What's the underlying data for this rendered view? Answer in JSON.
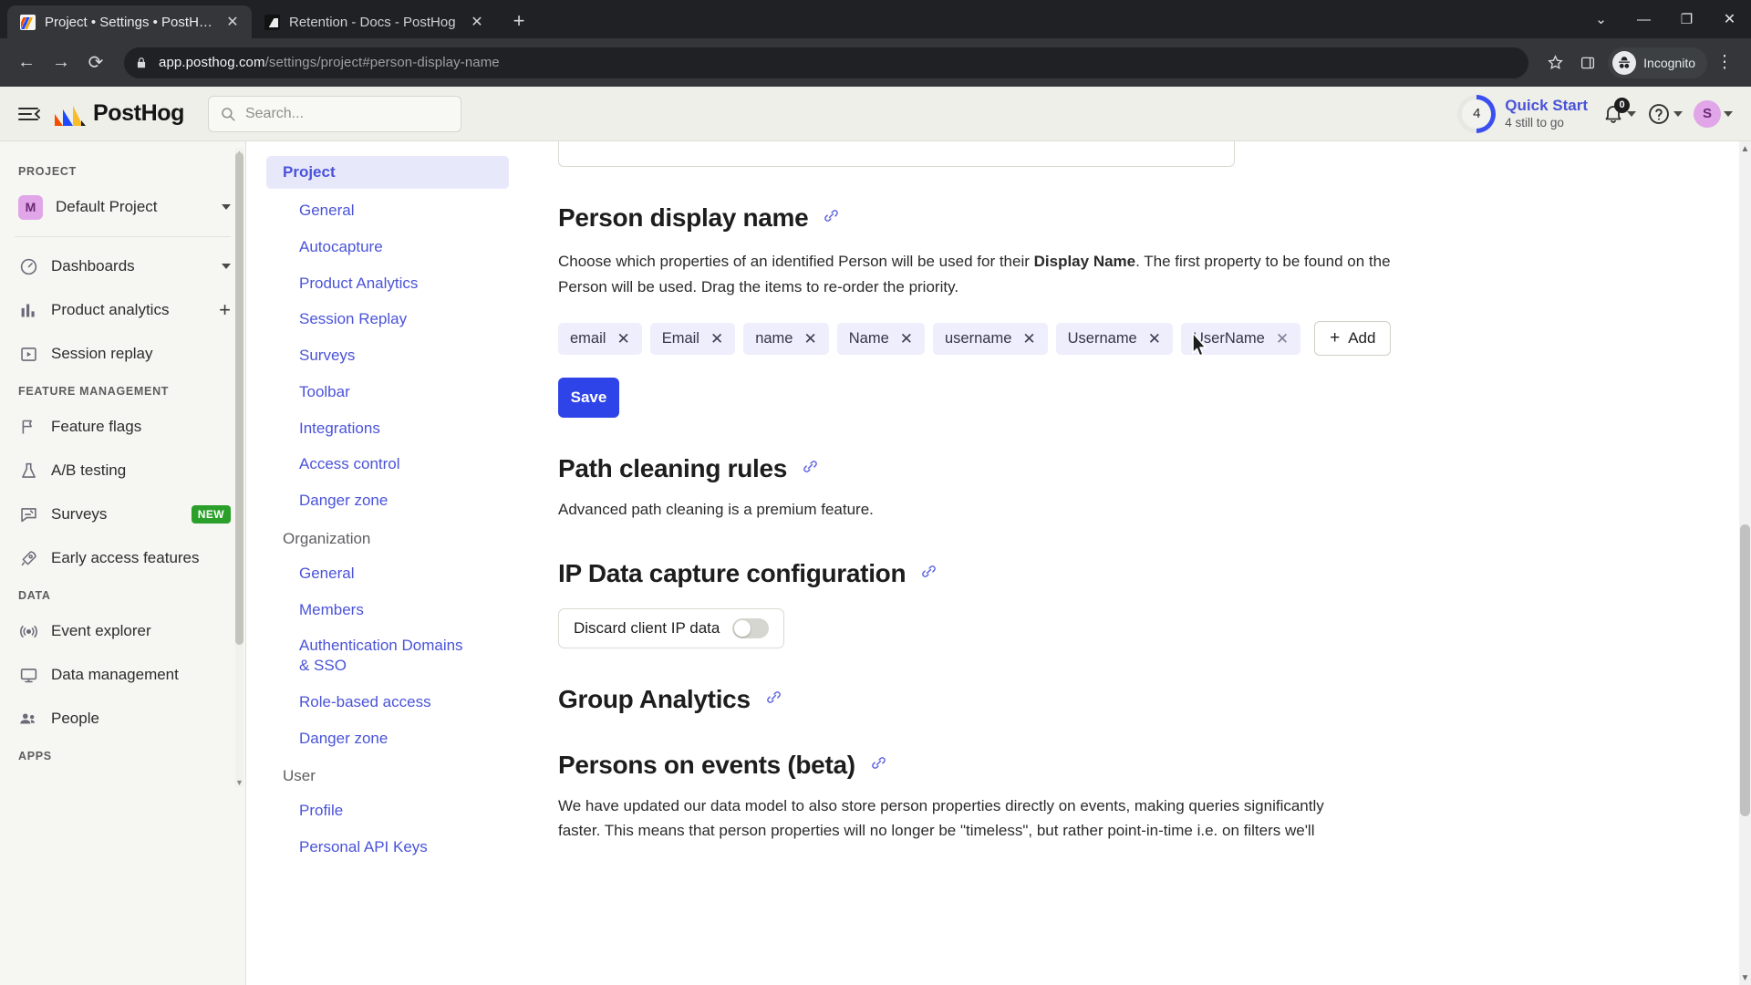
{
  "browser": {
    "tabs": [
      {
        "title": "Project • Settings • PostHog",
        "active": true,
        "close": "✕"
      },
      {
        "title": "Retention - Docs - PostHog",
        "active": false,
        "close": "✕"
      }
    ],
    "new_tab_label": "+",
    "window_controls": {
      "expand": "⌄",
      "minimize": "—",
      "maximize": "❐",
      "close": "✕"
    },
    "url_domain": "app.posthog.com",
    "url_path": "/settings/project#person-display-name",
    "profile_label": "Incognito",
    "back": "←",
    "forward": "→",
    "reload": "⟳",
    "bookmark_icon": "star-icon",
    "sidepanel_icon": "side-panel-icon",
    "menu_icon": "⋮"
  },
  "topbar": {
    "menu_toggle": "hamburger-icon",
    "brand": "PostHog",
    "search_placeholder": "Search...",
    "quick_start": {
      "title": "Quick Start",
      "subtitle": "4 still to go",
      "count": "4"
    },
    "notifications_badge": "0",
    "help_label": "?",
    "avatar_initial": "S"
  },
  "sidebar": {
    "sections": [
      {
        "label": "PROJECT",
        "items": [
          {
            "name": "project-selector",
            "label": "Default Project",
            "badge": "M",
            "chevron": true
          }
        ]
      },
      {
        "label": "",
        "items": [
          {
            "name": "dashboards",
            "label": "Dashboards",
            "icon": "gauge-icon",
            "chevron": true
          },
          {
            "name": "product-analytics",
            "label": "Product analytics",
            "icon": "bar-chart-icon",
            "plus": true
          },
          {
            "name": "session-replay",
            "label": "Session replay",
            "icon": "play-box-icon"
          }
        ]
      },
      {
        "label": "FEATURE MANAGEMENT",
        "items": [
          {
            "name": "feature-flags",
            "label": "Feature flags",
            "icon": "flag-icon"
          },
          {
            "name": "ab-testing",
            "label": "A/B testing",
            "icon": "flask-icon"
          },
          {
            "name": "surveys",
            "label": "Surveys",
            "icon": "survey-icon",
            "tag": "NEW"
          },
          {
            "name": "early-access-features",
            "label": "Early access features",
            "icon": "rocket-icon"
          }
        ]
      },
      {
        "label": "DATA",
        "items": [
          {
            "name": "event-explorer",
            "label": "Event explorer",
            "icon": "signal-icon"
          },
          {
            "name": "data-management",
            "label": "Data management",
            "icon": "monitor-icon"
          },
          {
            "name": "people",
            "label": "People",
            "icon": "people-icon"
          }
        ]
      },
      {
        "label": "APPS",
        "items": []
      }
    ]
  },
  "settings_nav": {
    "active": "Project",
    "groups": [
      {
        "label": "Project",
        "is_active_header": true,
        "links": [
          "General",
          "Autocapture",
          "Product Analytics",
          "Session Replay",
          "Surveys",
          "Toolbar",
          "Integrations",
          "Access control",
          "Danger zone"
        ]
      },
      {
        "label": "Organization",
        "is_active_header": false,
        "links": [
          "General",
          "Members",
          "Authentication Domains & SSO",
          "Role-based access",
          "Danger zone"
        ]
      },
      {
        "label": "User",
        "is_active_header": false,
        "links": [
          "Profile",
          "Personal API Keys"
        ]
      }
    ]
  },
  "main": {
    "person_display_name": {
      "title": "Person display name",
      "anchor_icon": "link-icon",
      "description_part1": "Choose which properties of an identified Person will be used for their ",
      "description_bold": "Display Name",
      "description_part2": ". The first property to be found on the Person will be used. Drag the items to re-order the priority.",
      "chips": [
        {
          "label": "email",
          "hovered": false
        },
        {
          "label": "Email",
          "hovered": false
        },
        {
          "label": "name",
          "hovered": false
        },
        {
          "label": "Name",
          "hovered": false
        },
        {
          "label": "username",
          "hovered": false
        },
        {
          "label": "Username",
          "hovered": false
        },
        {
          "label": "UserName",
          "hovered": true
        }
      ],
      "add_label": "Add",
      "add_icon": "plus-icon",
      "save_label": "Save"
    },
    "path_cleaning": {
      "title": "Path cleaning rules",
      "anchor_icon": "link-icon",
      "description": "Advanced path cleaning is a premium feature."
    },
    "ip_capture": {
      "title": "IP Data capture configuration",
      "anchor_icon": "link-icon",
      "toggle_label": "Discard client IP data",
      "toggle_on": false
    },
    "group_analytics": {
      "title": "Group Analytics",
      "anchor_icon": "link-icon"
    },
    "persons_on_events": {
      "title": "Persons on events (beta)",
      "anchor_icon": "link-icon",
      "description_line1": "We have updated our data model to also store person properties directly on events, making queries significantly",
      "description_line2": "faster. This means that person properties will no longer be \"timeless\", but rather point-in-time i.e. on filters we'll"
    }
  },
  "colors": {
    "accent": "#2f44e8",
    "link": "#4a53d8",
    "chip_bg": "#eeeefc",
    "topbar_bg": "#eeefe9",
    "badge_new": "#2aa02a"
  }
}
